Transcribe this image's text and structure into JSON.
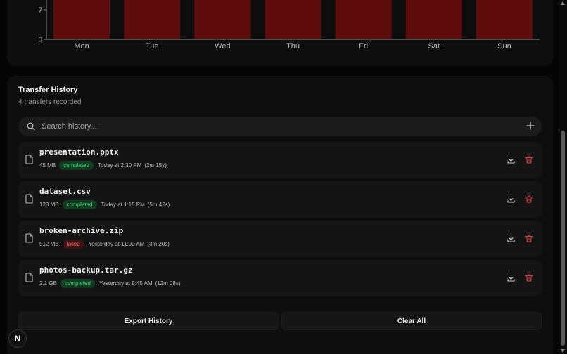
{
  "chart_data": {
    "type": "bar",
    "categories": [
      "Mon",
      "Tue",
      "Wed",
      "Thu",
      "Fri",
      "Sat",
      "Sun"
    ],
    "values": [
      10,
      10,
      10,
      10,
      10,
      10,
      10
    ],
    "yticks": [
      "0",
      "7"
    ],
    "title": "",
    "xlabel": "",
    "ylabel": "",
    "bar_color": "#5e0c0c",
    "grid": false
  },
  "history": {
    "title": "Transfer History",
    "subtitle": "4 transfers recorded",
    "search_placeholder": "Search history...",
    "items": [
      {
        "name": "presentation.pptx",
        "size": "45 MB",
        "status": "completed",
        "when": "Today at 2:30 PM",
        "duration": "(2m 15s)"
      },
      {
        "name": "dataset.csv",
        "size": "128 MB",
        "status": "completed",
        "when": "Today at 1:15 PM",
        "duration": "(5m 42s)"
      },
      {
        "name": "broken-archive.zip",
        "size": "512 MB",
        "status": "failed",
        "when": "Yesterday at 11:00 AM",
        "duration": "(3m 20s)"
      },
      {
        "name": "photos-backup.tar.gz",
        "size": "2.1 GB",
        "status": "completed",
        "when": "Yesterday at 9:45 AM",
        "duration": "(12m 08s)"
      }
    ],
    "export_label": "Export History",
    "clear_label": "Clear All"
  },
  "colors": {
    "completed": "#4ade80",
    "failed": "#f87171",
    "delete": "#e04848",
    "background": "#050505",
    "card": "#0e0e0e"
  },
  "n_badge": "N"
}
